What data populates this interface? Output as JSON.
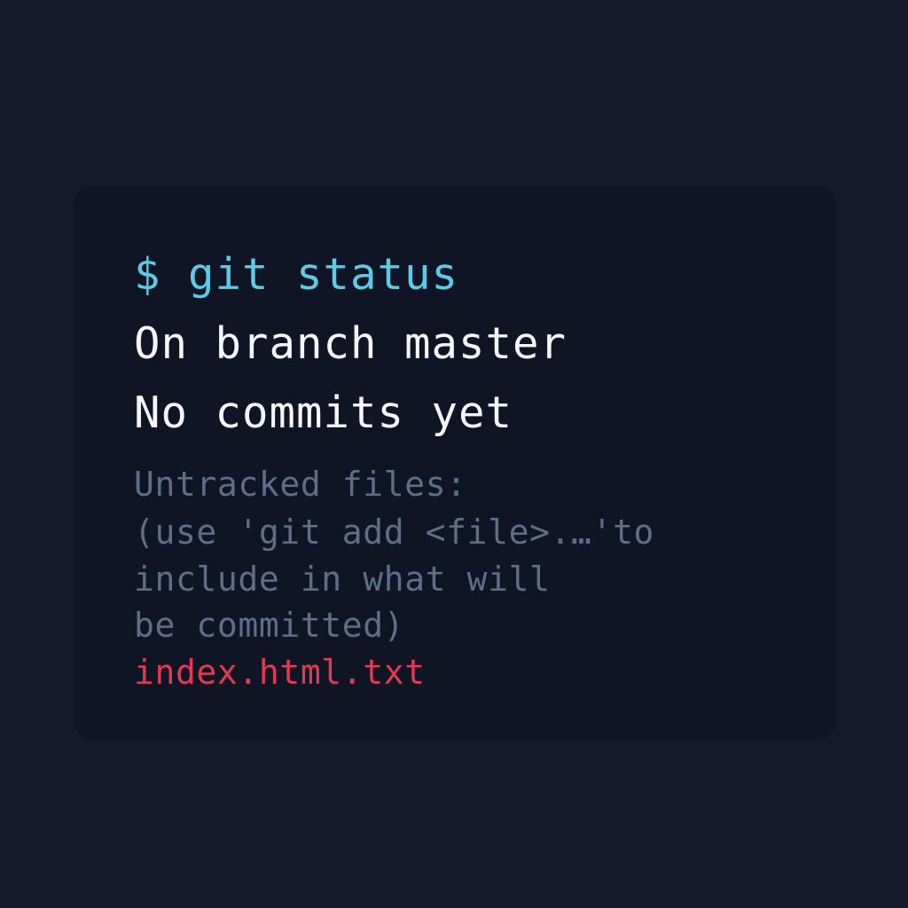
{
  "terminal": {
    "command": "$ git status",
    "output": [
      "On branch master",
      "No commits yet"
    ],
    "hint_lines": [
      "Untracked files:",
      "(use 'git add <file>.…'to",
      "include in what will",
      "be committed)"
    ],
    "untracked_file": "index.html.txt"
  },
  "colors": {
    "page_background": "#141a29",
    "card_background": "#0f1524",
    "command": "#5ccbe8",
    "output": "#f4f6fa",
    "hint": "#5e6d88",
    "untracked_file": "#e33a54"
  }
}
